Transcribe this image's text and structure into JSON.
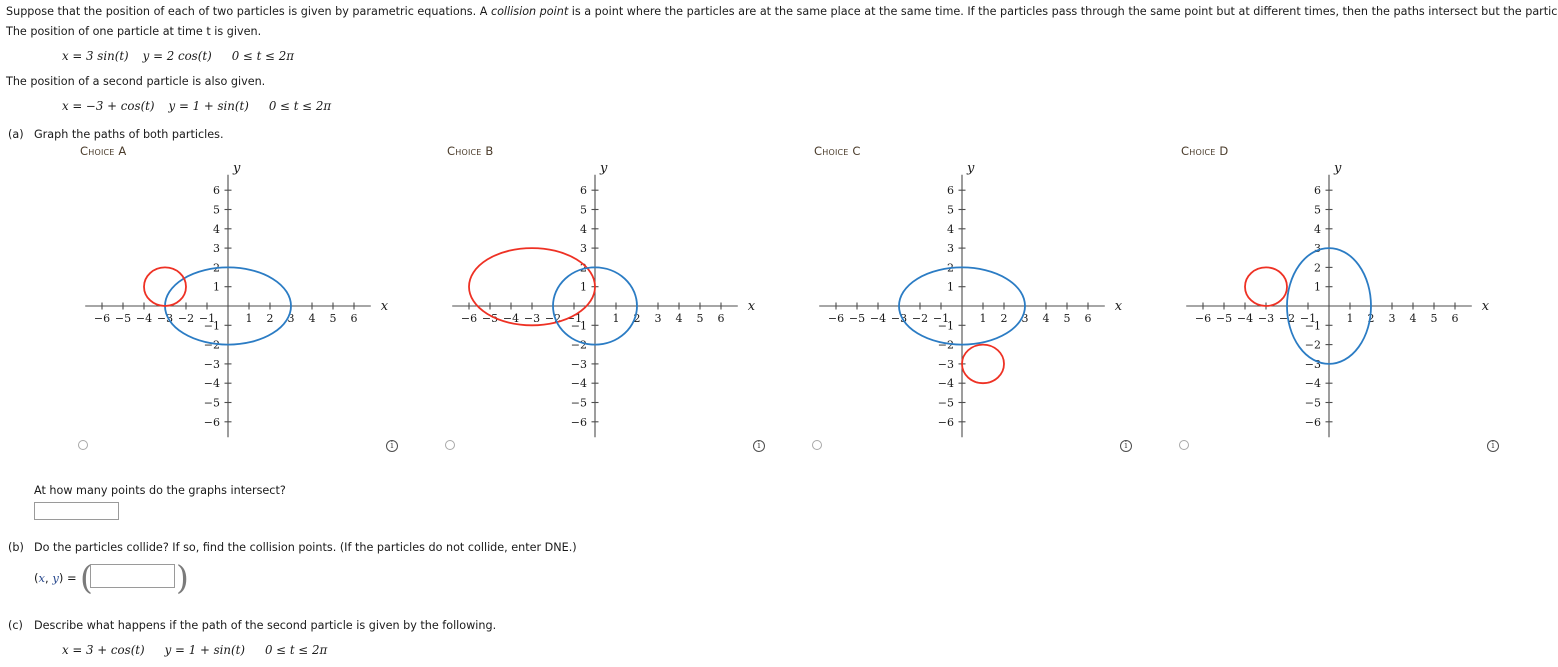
{
  "intro": {
    "text_part1": "Suppose that the position of each of two particles is given by parametric equations. A ",
    "emph": "collision point",
    "text_part2": " is a point where the particles are at the same place at the same time. If the particles pass through the same point but at different times, then the paths intersect but the particles don't collide."
  },
  "statements": {
    "first": "The position of one particle at time t is given.",
    "second": "The position of a second particle is also given."
  },
  "equations": {
    "particle1": {
      "x": "x = 3 sin(t)",
      "y": "y = 2 cos(t)",
      "domain": "0 ≤ t ≤ 2π"
    },
    "particle2": {
      "x": "x = −3 + cos(t)",
      "y": "y = 1 + sin(t)",
      "domain": "0 ≤ t ≤ 2π"
    },
    "particle3": {
      "x": "x = 3 + cos(t)",
      "y": "y = 1 + sin(t)",
      "domain": "0 ≤ t ≤ 2π"
    }
  },
  "parts": {
    "a": {
      "marker": "(a)",
      "prompt": "Graph the paths of both particles."
    },
    "b": {
      "marker": "(b)",
      "prompt": "Do the particles collide? If so, find the collision points. (If the particles do not collide, enter DNE.)"
    },
    "c": {
      "marker": "(c)",
      "prompt": "Describe what happens if the path of the second particle is given by the following."
    }
  },
  "intersect_question": "At how many points do the graphs intersect?",
  "answers": {
    "intersect_value": "",
    "intersect_placeholder": "",
    "xy_label_open": "(",
    "xy_label_x": "x",
    "xy_label_comma": ", ",
    "xy_label_y": "y",
    "xy_label_close": ") = ",
    "collision_value": "",
    "collision_placeholder": "",
    "paren_open": "(",
    "paren_close": ")"
  },
  "icons": {
    "info": "i"
  },
  "colors": {
    "red_curve": "#ee3124",
    "blue_curve": "#2b7cc4",
    "axis": "#4d4d4d",
    "choice_label": "#4a3b2a",
    "box_border": "#9a9a9a"
  },
  "chart_data": [
    {
      "type": "scatter",
      "id": "choice-a",
      "label": "Choice A",
      "xlabel": "x",
      "ylabel": "y",
      "xlim": [
        -6.8,
        6.8
      ],
      "ylim": [
        -6.8,
        6.8
      ],
      "xticks": [
        -6,
        -5,
        -4,
        -3,
        -2,
        -1,
        1,
        2,
        3,
        4,
        5,
        6
      ],
      "yticks": [
        6,
        5,
        4,
        3,
        2,
        1,
        -1,
        -2,
        -3,
        -4,
        -5,
        -6
      ],
      "grid": false,
      "curves": [
        {
          "name": "blue-ellipse",
          "shape": "ellipse",
          "cx": 0,
          "cy": 0,
          "rx": 3,
          "ry": 2,
          "color": "#2b7cc4"
        },
        {
          "name": "red-circle",
          "shape": "ellipse",
          "cx": -3,
          "cy": 1,
          "rx": 1,
          "ry": 1,
          "color": "#ee3124"
        }
      ]
    },
    {
      "type": "scatter",
      "id": "choice-b",
      "label": "Choice B",
      "xlabel": "x",
      "ylabel": "y",
      "xlim": [
        -6.8,
        6.8
      ],
      "ylim": [
        -6.8,
        6.8
      ],
      "xticks": [
        -6,
        -5,
        -4,
        -3,
        -2,
        -1,
        1,
        2,
        3,
        4,
        5,
        6
      ],
      "yticks": [
        6,
        5,
        4,
        3,
        2,
        1,
        -1,
        -2,
        -3,
        -4,
        -5,
        -6
      ],
      "grid": false,
      "curves": [
        {
          "name": "red-ellipse",
          "shape": "ellipse",
          "cx": -3,
          "cy": 1,
          "rx": 3,
          "ry": 2,
          "color": "#ee3124"
        },
        {
          "name": "blue-circle",
          "shape": "ellipse",
          "cx": 0,
          "cy": 0,
          "rx": 2,
          "ry": 2,
          "color": "#2b7cc4"
        }
      ]
    },
    {
      "type": "scatter",
      "id": "choice-c",
      "label": "Choice C",
      "xlabel": "x",
      "ylabel": "y",
      "xlim": [
        -6.8,
        6.8
      ],
      "ylim": [
        -6.8,
        6.8
      ],
      "xticks": [
        -6,
        -5,
        -4,
        -3,
        -2,
        -1,
        1,
        2,
        3,
        4,
        5,
        6
      ],
      "yticks": [
        6,
        5,
        4,
        3,
        2,
        1,
        -1,
        -2,
        -3,
        -4,
        -5,
        -6
      ],
      "grid": false,
      "curves": [
        {
          "name": "blue-ellipse",
          "shape": "ellipse",
          "cx": 0,
          "cy": 0,
          "rx": 3,
          "ry": 2,
          "color": "#2b7cc4"
        },
        {
          "name": "red-circle",
          "shape": "ellipse",
          "cx": 1,
          "cy": -3,
          "rx": 1,
          "ry": 1,
          "color": "#ee3124"
        }
      ]
    },
    {
      "type": "scatter",
      "id": "choice-d",
      "label": "Choice D",
      "xlabel": "x",
      "ylabel": "y",
      "xlim": [
        -6.8,
        6.8
      ],
      "ylim": [
        -6.8,
        6.8
      ],
      "xticks": [
        -6,
        -5,
        -4,
        -3,
        -2,
        -1,
        1,
        2,
        3,
        4,
        5,
        6
      ],
      "yticks": [
        6,
        5,
        4,
        3,
        2,
        1,
        -1,
        -2,
        -3,
        -4,
        -5,
        -6
      ],
      "grid": false,
      "curves": [
        {
          "name": "blue-ellipse",
          "shape": "ellipse",
          "cx": 0,
          "cy": 0,
          "rx": 2,
          "ry": 3,
          "color": "#2b7cc4"
        },
        {
          "name": "red-circle",
          "shape": "ellipse",
          "cx": -3,
          "cy": 1,
          "rx": 1,
          "ry": 1,
          "color": "#ee3124"
        }
      ]
    }
  ]
}
